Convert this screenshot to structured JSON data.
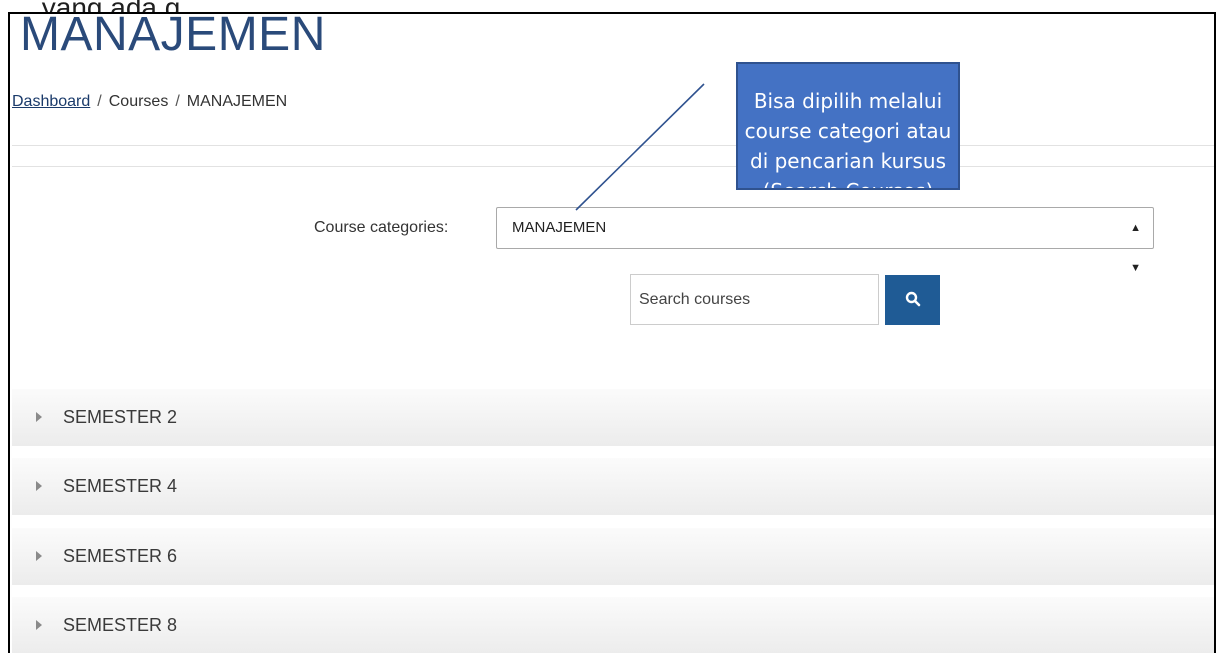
{
  "top_text": "… yang ada g…",
  "page_title": "MANAJEMEN",
  "breadcrumb": {
    "items": [
      "Dashboard",
      "Courses",
      "MANAJEMEN"
    ],
    "separator": "/"
  },
  "category": {
    "label": "Course categories:",
    "selected": "MANAJEMEN"
  },
  "search": {
    "placeholder": "Search courses",
    "button_icon": "search-icon"
  },
  "sections": [
    "SEMESTER 2",
    "SEMESTER 4",
    "SEMESTER 6",
    "SEMESTER 8"
  ],
  "callout": {
    "text": "Bisa dipilih melalui course categori atau di pencarian kursus (Search Courses)"
  },
  "colors": {
    "title": "#2a4a7a",
    "button": "#1f5b95",
    "callout": "#4472c4"
  }
}
